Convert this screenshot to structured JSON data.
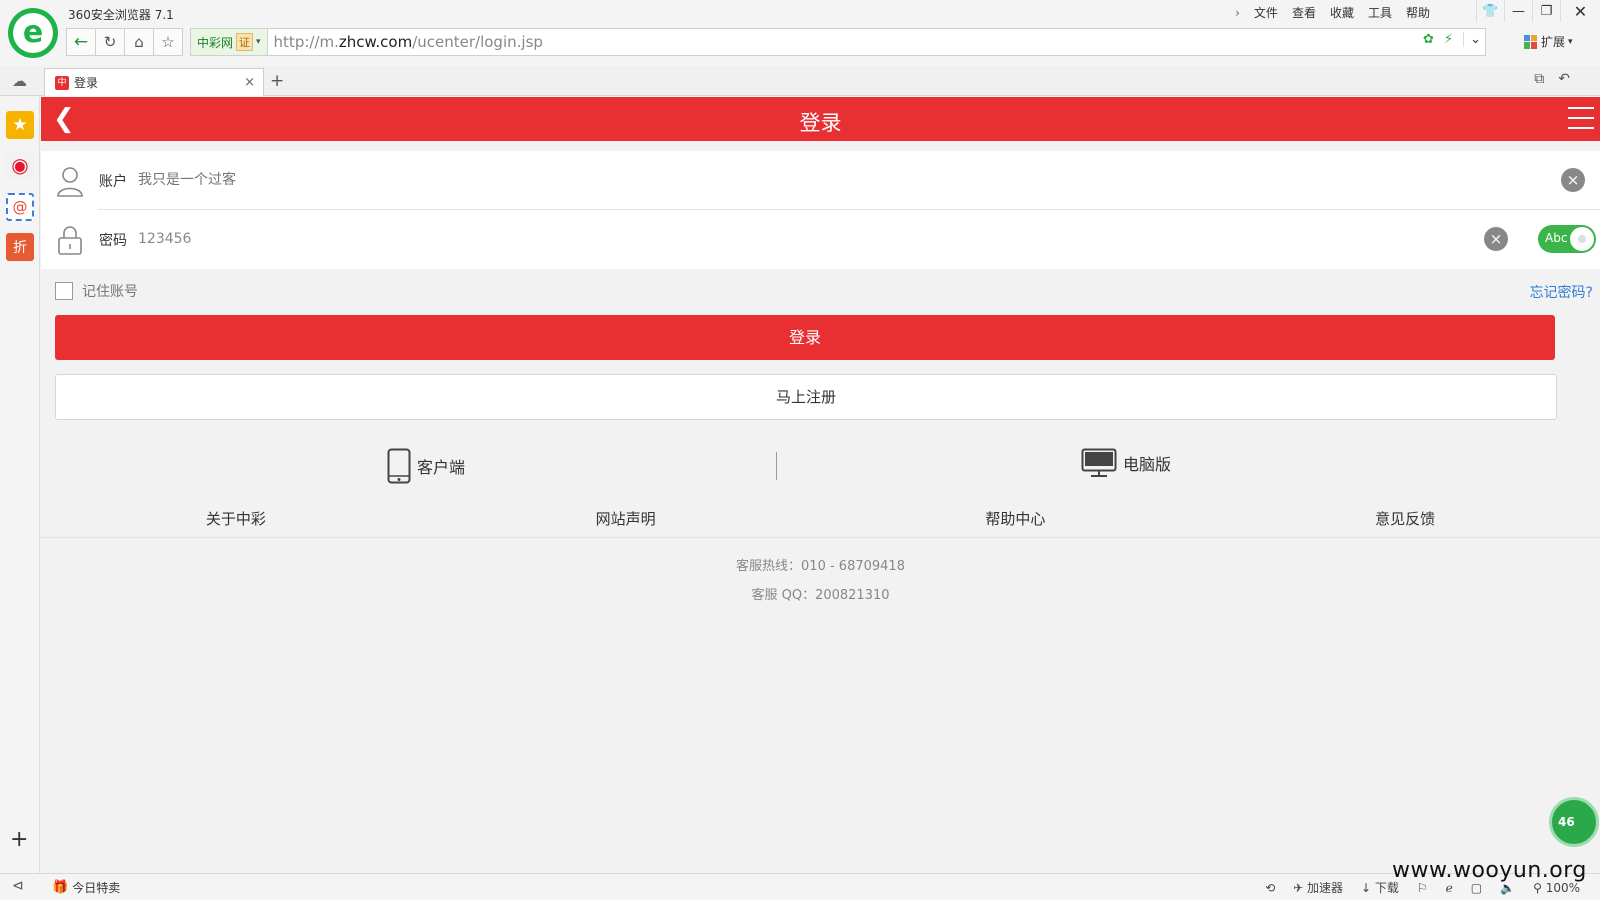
{
  "browser": {
    "app_title": "360安全浏览器 7.1",
    "menu": [
      "文件",
      "查看",
      "收藏",
      "工具",
      "帮助"
    ],
    "site_badge": "中彩网",
    "cert_label": "证",
    "url_prefix": "http://m.",
    "url_host": "zhcw.com",
    "url_path": "/ucenter/login.jsp",
    "extensions_label": "扩展",
    "tab_title": "登录",
    "status_today": "今日特卖",
    "status_accelerator": "加速器",
    "status_download": "下载",
    "status_zoom": "100%"
  },
  "page": {
    "title": "登录",
    "account_label": "账户",
    "account_placeholder": "我只是一个过客",
    "password_label": "密码",
    "password_value": "123456",
    "toggle_label": "Abc",
    "remember_label": "记住账号",
    "forgot_label": "忘记密码?",
    "login_button": "登录",
    "register_button": "马上注册",
    "client_label": "客户端",
    "pc_label": "电脑版",
    "footer_links": [
      "关于中彩",
      "网站声明",
      "帮助中心",
      "意见反馈"
    ],
    "hotline": "客服热线：010 - 68709418",
    "qq": "客服 QQ：200821310",
    "badge_text": "46"
  },
  "watermark": "www.wooyun.org",
  "colors": {
    "brand_red": "#e83032",
    "link_blue": "#2f7fd6",
    "toggle_green": "#3bb54a"
  }
}
